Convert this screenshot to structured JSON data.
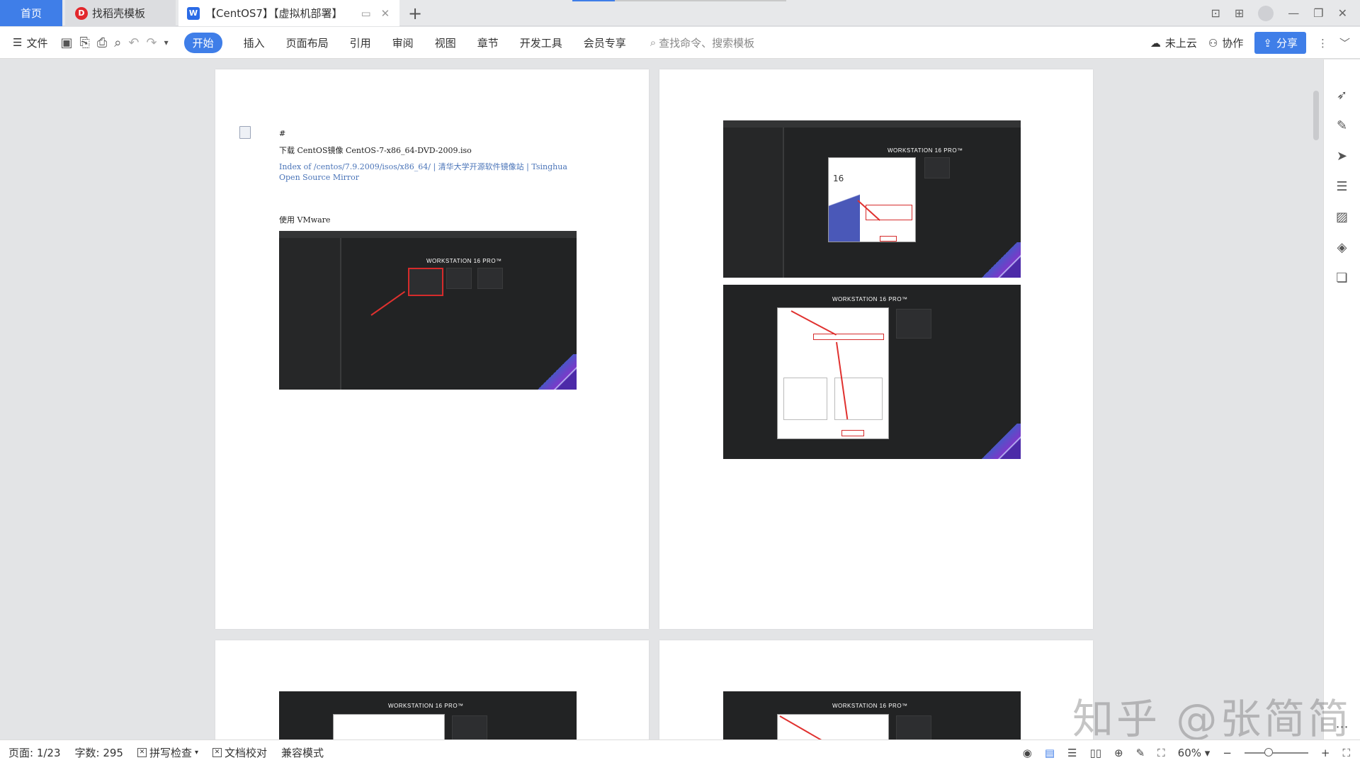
{
  "tabs": {
    "home": "首页",
    "template": "找稻壳模板",
    "document": "【CentOS7】【虚拟机部署】",
    "new_tab": "+"
  },
  "ribbon": {
    "file": "文件",
    "start": "开始",
    "insert": "插入",
    "layout": "页面布局",
    "reference": "引用",
    "review": "审阅",
    "view": "视图",
    "chapter": "章节",
    "devtools": "开发工具",
    "member": "会员专享",
    "search_placeholder": "查找命令、搜索模板",
    "cloud": "未上云",
    "collab": "协作",
    "share": "分享"
  },
  "page1": {
    "hash": "#",
    "download_line": "下载 CentOS镜像 CentOS-7-x86_64-DVD-2009.iso",
    "link_line1": "Index of /centos/7.9.2009/isos/x86_64/ | 清华大学开源软件镜像站 | Tsinghua",
    "link_line2": "Open Source Mirror",
    "vmware_line": "使用 VMware"
  },
  "screenshots": {
    "ws_title": "WORKSTATION 16 PRO™",
    "ws_version": "16"
  },
  "watermark": "知乎 @张简简",
  "status": {
    "page": "页面: 1/23",
    "words": "字数: 295",
    "spellcheck": "拼写检查",
    "proof": "文档校对",
    "compat": "兼容模式",
    "zoom": "60%"
  },
  "colors": {
    "accent": "#3f7ee8",
    "vm_bg": "#222324",
    "annotation_red": "#e0312f"
  }
}
